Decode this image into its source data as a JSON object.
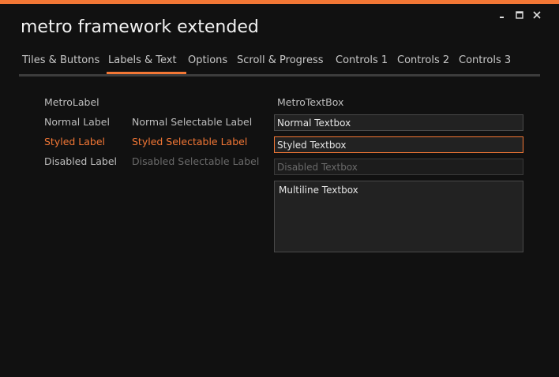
{
  "window": {
    "title": "metro framework extended",
    "accent_color": "#f37735",
    "controls": [
      {
        "name": "minimize-icon"
      },
      {
        "name": "maximize-icon"
      },
      {
        "name": "close-icon"
      }
    ]
  },
  "tabs": {
    "items": [
      {
        "label": "Tiles & Buttons"
      },
      {
        "label": "Labels & Text"
      },
      {
        "label": "Options"
      },
      {
        "label": "Scroll & Progress"
      },
      {
        "label": "Controls 1"
      },
      {
        "label": "Controls 2"
      },
      {
        "label": "Controls 3"
      }
    ],
    "selected": "Labels & Text"
  },
  "labels_panel": {
    "header": "MetroLabel",
    "normal": "Normal Label",
    "normal_selectable": "Normal Selectable Label",
    "styled": "Styled Label",
    "styled_selectable": "Styled Selectable Label",
    "disabled": "Disabled Label",
    "disabled_selectable": "Disabled Selectable Label"
  },
  "textbox_panel": {
    "header": "MetroTextBox",
    "normal_value": "Normal Textbox",
    "styled_value": "Styled Textbox",
    "disabled_value": "Disabled Textbox",
    "multiline_value": "Multiline Textbox"
  }
}
